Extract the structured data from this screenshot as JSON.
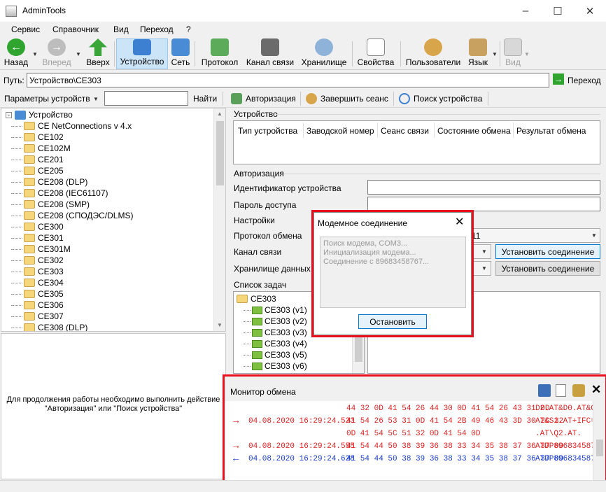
{
  "window": {
    "title": "AdminTools"
  },
  "menu": [
    "Сервис",
    "Справочник",
    "Вид",
    "Переход",
    "?"
  ],
  "toolbar": {
    "back": "Назад",
    "forward": "Вперед",
    "up": "Вверх",
    "device": "Устройство",
    "network": "Сеть",
    "protocol": "Протокол",
    "channel": "Канал связи",
    "storage": "Хранилище",
    "properties": "Свойства",
    "users": "Пользователи",
    "language": "Язык",
    "view": "Вид"
  },
  "path": {
    "label": "Путь:",
    "value": "Устройство\\CE303",
    "go": "Переход"
  },
  "bar2": {
    "params": "Параметры устройств",
    "search_value": "",
    "find": "Найти",
    "auth": "Авторизация",
    "end_session": "Завершить сеанс",
    "device_search": "Поиск устройства"
  },
  "tree": {
    "root": "Устройство",
    "items": [
      "CE NetConnections v 4.x",
      "CE102",
      "CE102M",
      "CE201",
      "CE205",
      "CE208 (DLP)",
      "CE208 (IEC61107)",
      "CE208 (SMP)",
      "CE208 (СПОДЭС/DLMS)",
      "CE300",
      "CE301",
      "CE301M",
      "CE302",
      "CE303",
      "CE304",
      "CE305",
      "CE306",
      "CE307",
      "CE308 (DLP)"
    ]
  },
  "hint": {
    "line1": "Для продолжения работы необходимо выполнить действие",
    "line2": "\"Авторизация\" или \"Поиск устройства\""
  },
  "device_panel": {
    "title": "Устройство",
    "columns": [
      "Тип устройства",
      "Заводской номер",
      "Сеанс связи",
      "Состояние обмена",
      "Результат обмена"
    ]
  },
  "auth_panel": {
    "title": "Авторизация",
    "id_label": "Идентификатор устройства",
    "id_value": "",
    "pwd_label": "Пароль доступа",
    "pwd_value": ""
  },
  "settings_panel": {
    "title": "Настройки",
    "protocol_label": "Протокол обмена",
    "protocol_value_tail": "11",
    "channel_label": "Канал связи",
    "storage_label": "Хранилище данных",
    "connect1": "Установить соединение",
    "connect2": "Установить соединение"
  },
  "tasks_panel": {
    "title": "Список задач",
    "root": "CE303",
    "items": [
      "CE303 (v1)",
      "CE303 (v2)",
      "CE303 (v3)",
      "CE303 (v4)",
      "CE303 (v5)",
      "CE303 (v6)"
    ]
  },
  "modal": {
    "title": "Модемное соединение",
    "log": [
      "Поиск модема, COM3...",
      "Инициализация модема...",
      "Соединение с 89683458767..."
    ],
    "stop": "Остановить"
  },
  "monitor": {
    "title": "Монитор обмена",
    "rows": [
      {
        "dir": "",
        "time": "",
        "hex": "44 32 0D 41 54 26 44 30 0D 41 54 26 43 31 0D",
        "ascii": "D2.AT&D0.AT&C",
        "color": "red"
      },
      {
        "dir": "→",
        "time": "04.08.2020 16:29:24.523",
        "hex": "41 54 26 53 31 0D 41 54 2B 49 46 43 3D 30 2C 32",
        "ascii": "AT&S1.AT+IFC=",
        "color": "red"
      },
      {
        "dir": "",
        "time": "",
        "hex": "0D 41 54 5C 51 32 0D 41 54 0D",
        "ascii": ".AT\\Q2.AT.",
        "color": "red"
      },
      {
        "dir": "→",
        "time": "04.08.2020 16:29:24.555",
        "hex": "41 54 44 50 38 39 36 38 33 34 35 38 37 36 37 0D",
        "ascii": "ATDP896834587",
        "color": "red"
      },
      {
        "dir": "←",
        "time": "04.08.2020 16:29:24.628",
        "hex": "41 54 44 50 38 39 36 38 33 34 35 38 37 36 37 0D",
        "ascii": "ATDP896834587",
        "color": "blue"
      }
    ]
  },
  "colors": {
    "highlight": "#e8101c",
    "out": "#e02020",
    "in": "#1a3cd0",
    "selected_tool": "#cce4f7"
  }
}
